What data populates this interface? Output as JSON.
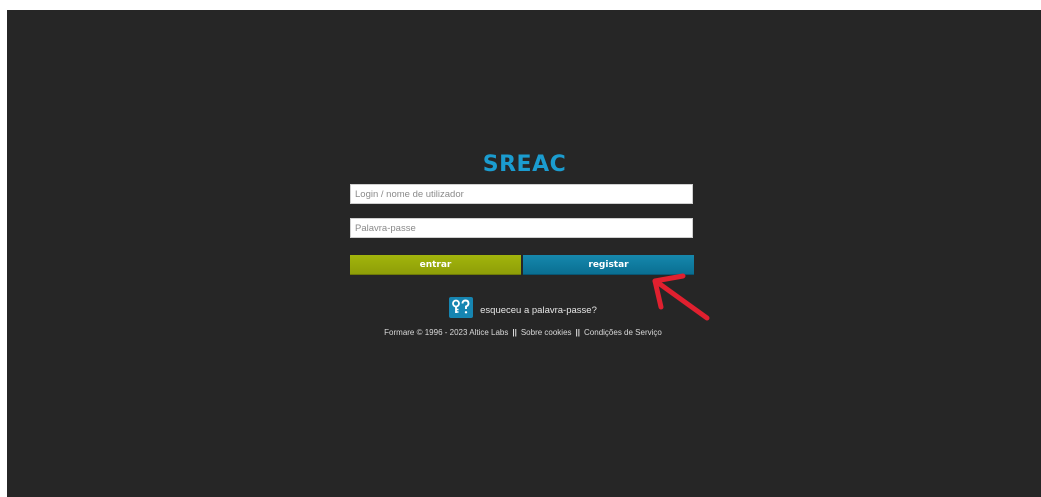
{
  "title": "SREAC",
  "form": {
    "login_placeholder": "Login / nome de utilizador",
    "password_placeholder": "Palavra-passe",
    "entrar_label": "entrar",
    "registar_label": "registar"
  },
  "forgot": {
    "icon": "keys-icon",
    "label": "esqueceu a palavra-passe?"
  },
  "footer": {
    "copyright": "Formare © 1996 - 2023 Altice Labs",
    "separator": "||",
    "cookies": "Sobre cookies",
    "terms": "Condições de Serviço"
  },
  "annotation": {
    "icon": "red-arrow-icon",
    "color": "#e0202f"
  },
  "colors": {
    "background": "#262626",
    "title": "#1b9ccf",
    "entrar": "#9aad0a",
    "registar": "#0f7fa4"
  }
}
